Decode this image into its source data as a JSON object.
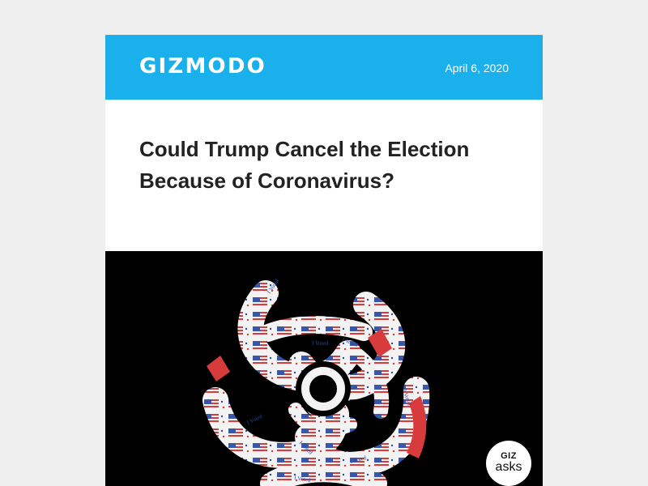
{
  "header": {
    "brand": "GIZMODO",
    "date": "April 6, 2020",
    "background_color": "#1ab0ec"
  },
  "article": {
    "headline": "Could Trump Cancel the Election Because of Coronavirus?"
  },
  "hero_image": {
    "sticker_text": "I Voted",
    "badge_top": "GIZ",
    "badge_bottom": "asks",
    "background_color": "#000000"
  }
}
